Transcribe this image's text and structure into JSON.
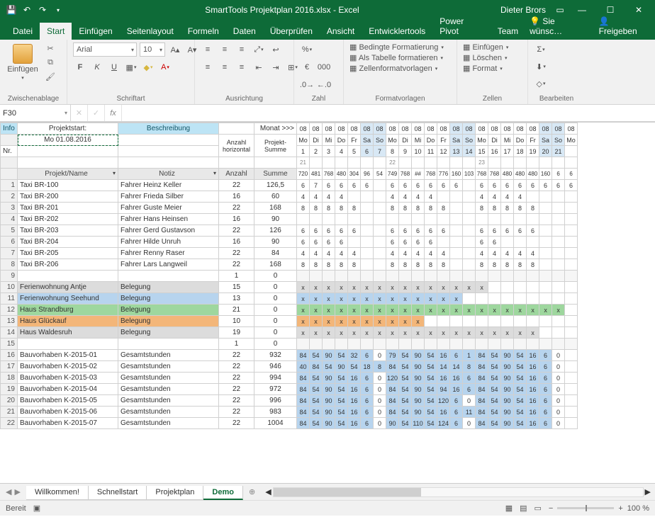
{
  "title": "SmartTools Projektplan 2016.xlsx - Excel",
  "user": "Dieter Brors",
  "ribbon_tabs": [
    "Datei",
    "Start",
    "Einfügen",
    "Seitenlayout",
    "Formeln",
    "Daten",
    "Überprüfen",
    "Ansicht",
    "Entwicklertools",
    "Power Pivot",
    "Team"
  ],
  "ribbon_active": 1,
  "wish_label": "Sie wünsc…",
  "share_label": "Freigeben",
  "groups": {
    "clipboard": "Zwischenablage",
    "font": "Schriftart",
    "align": "Ausrichtung",
    "number": "Zahl",
    "styles": "Formatvorlagen",
    "cells": "Zellen",
    "editing": "Bearbeiten"
  },
  "paste_label": "Einfügen",
  "font_name": "Arial",
  "font_size": "10",
  "font_btns": {
    "bold": "F",
    "italic": "K",
    "underline": "U"
  },
  "styles_items": [
    "Bedingte Formatierung",
    "Als Tabelle formatieren",
    "Zellenformatvorlagen"
  ],
  "cells_items": [
    "Einfügen",
    "Löschen",
    "Format"
  ],
  "namebox": "F30",
  "fx": "fx",
  "headers": {
    "info": "Info",
    "projektstart": "Projektstart:",
    "beschreibung": "Beschreibung",
    "monat": "Monat >>>",
    "anzahl_h": "Anzahl\nhorizontal",
    "projekt_summe": "Projekt-\nSumme",
    "nr": "Nr.",
    "projekt_name": "Projekt/Name",
    "notiz": "Notiz",
    "anzahl": "Anzahl",
    "summe": "Summe"
  },
  "projektstart_date": "Mo 01.08.2016",
  "day_months": [
    "08",
    "08",
    "08",
    "08",
    "08",
    "08",
    "08",
    "08",
    "08",
    "08",
    "08",
    "08",
    "08",
    "08",
    "08",
    "08",
    "08",
    "08",
    "08",
    "08",
    "08",
    "08"
  ],
  "weekdays": [
    "Mo",
    "Di",
    "Mi",
    "Do",
    "Fr",
    "Sa",
    "So",
    "Mo",
    "Di",
    "Mi",
    "Do",
    "Fr",
    "Sa",
    "So",
    "Mo",
    "Di",
    "Mi",
    "Do",
    "Fr",
    "Sa",
    "So",
    "Mo"
  ],
  "daynums": [
    "1",
    "2",
    "3",
    "4",
    "5",
    "6",
    "7",
    "8",
    "9",
    "10",
    "11",
    "12",
    "13",
    "14",
    "15",
    "16",
    "17",
    "18",
    "19",
    "20",
    "21",
    ""
  ],
  "weeknums": [
    "21",
    "",
    "",
    "",
    "",
    "",
    "",
    "22",
    "",
    "",
    "",
    "",
    "",
    "",
    "23",
    "",
    "",
    "",
    "",
    "",
    "",
    ""
  ],
  "totals_row": [
    "720",
    "481",
    "768",
    "480",
    "304",
    "96",
    "54",
    "749",
    "768",
    "##",
    "768",
    "776",
    "160",
    "103",
    "768",
    "768",
    "480",
    "480",
    "480",
    "160",
    "6",
    "6"
  ],
  "rows": [
    {
      "n": 1,
      "name": "Taxi BR-100",
      "notiz": "Fahrer Heinz Keller",
      "anz": 22,
      "sum": "126,5",
      "cells": [
        "6",
        "7",
        "6",
        "6",
        "6",
        "6",
        "",
        "6",
        "6",
        "6",
        "6",
        "6",
        "6",
        "",
        "6",
        "6",
        "6",
        "6",
        "6",
        "6",
        "6",
        "6"
      ]
    },
    {
      "n": 2,
      "name": "Taxi BR-200",
      "notiz": "Fahrer Frieda Silber",
      "anz": 16,
      "sum": "60",
      "cells": [
        "4",
        "4",
        "4",
        "4",
        "",
        "",
        "",
        "4",
        "4",
        "4",
        "4",
        "",
        "",
        "",
        "4",
        "4",
        "4",
        "4",
        "",
        "",
        "",
        ""
      ]
    },
    {
      "n": 3,
      "name": "Taxi BR-201",
      "notiz": "Fahrer Guste Meier",
      "anz": 22,
      "sum": "168",
      "cells": [
        "8",
        "8",
        "8",
        "8",
        "8",
        "",
        "",
        "8",
        "8",
        "8",
        "8",
        "8",
        "",
        "",
        "8",
        "8",
        "8",
        "8",
        "8",
        "",
        "",
        ""
      ]
    },
    {
      "n": 4,
      "name": "Taxi BR-202",
      "notiz": "Fahrer Hans Heinsen",
      "anz": 16,
      "sum": "90",
      "cells": [
        "",
        "",
        "",
        "",
        "",
        "",
        "",
        "",
        "",
        "",
        "",
        "",
        "",
        "",
        "",
        "",
        "",
        "",
        "",
        "",
        "",
        ""
      ]
    },
    {
      "n": 5,
      "name": "Taxi BR-203",
      "notiz": "Fahrer Gerd Gustavson",
      "anz": 22,
      "sum": "126",
      "cells": [
        "6",
        "6",
        "6",
        "6",
        "6",
        "",
        "",
        "6",
        "6",
        "6",
        "6",
        "6",
        "",
        "",
        "6",
        "6",
        "6",
        "6",
        "6",
        "",
        "",
        ""
      ]
    },
    {
      "n": 6,
      "name": "Taxi BR-204",
      "notiz": "Fahrer Hilde Unruh",
      "anz": 16,
      "sum": "90",
      "cells": [
        "6",
        "6",
        "6",
        "6",
        "",
        "",
        "",
        "6",
        "6",
        "6",
        "6",
        "",
        "",
        "",
        "6",
        "6",
        "",
        "",
        "",
        "",
        "",
        ""
      ]
    },
    {
      "n": 7,
      "name": "Taxi BR-205",
      "notiz": "Fahrer Renny Raser",
      "anz": 22,
      "sum": "84",
      "cells": [
        "4",
        "4",
        "4",
        "4",
        "4",
        "",
        "",
        "4",
        "4",
        "4",
        "4",
        "4",
        "",
        "",
        "4",
        "4",
        "4",
        "4",
        "4",
        "",
        "",
        ""
      ]
    },
    {
      "n": 8,
      "name": "Taxi BR-206",
      "notiz": "Fahrer Lars Langweil",
      "anz": 22,
      "sum": "168",
      "cells": [
        "8",
        "8",
        "8",
        "8",
        "8",
        "",
        "",
        "8",
        "8",
        "8",
        "8",
        "8",
        "",
        "",
        "8",
        "8",
        "8",
        "8",
        "8",
        "",
        "",
        ""
      ]
    },
    {
      "n": 9,
      "name": "",
      "notiz": "",
      "anz": 1,
      "sum": "0",
      "blank": true,
      "cells": [
        "",
        "",
        "",
        "",
        "",
        "",
        "",
        "",
        "",
        "",
        "",
        "",
        "",
        "",
        "",
        "",
        "",
        "",
        "",
        "",
        "",
        ""
      ]
    },
    {
      "n": 10,
      "name": "Ferienwohnung Antje",
      "notiz": "Belegung",
      "anz": 15,
      "sum": "0",
      "fill": "fillgrey",
      "mark": {
        "from": 0,
        "to": 14,
        "cls": "fillgrey"
      },
      "cells": [
        "x",
        "x",
        "x",
        "x",
        "x",
        "x",
        "x",
        "x",
        "x",
        "x",
        "x",
        "x",
        "x",
        "x",
        "x",
        "",
        "",
        "",
        "",
        "",
        "",
        ""
      ]
    },
    {
      "n": 11,
      "name": "Ferienwohnung Seehund",
      "notiz": "Belegung",
      "anz": 13,
      "sum": "0",
      "fill": "fillblue",
      "mark": {
        "from": 0,
        "to": 12,
        "cls": "fillblue"
      },
      "cells": [
        "x",
        "x",
        "x",
        "x",
        "x",
        "x",
        "x",
        "x",
        "x",
        "x",
        "x",
        "x",
        "x",
        "",
        "",
        "",
        "",
        "",
        "",
        "",
        "",
        ""
      ]
    },
    {
      "n": 12,
      "name": "Haus Strandburg",
      "notiz": "Belegung",
      "anz": 21,
      "sum": "0",
      "fill": "fillgreen",
      "mark": {
        "from": 0,
        "to": 20,
        "cls": "fillgreen"
      },
      "cells": [
        "x",
        "x",
        "x",
        "x",
        "x",
        "x",
        "x",
        "x",
        "x",
        "x",
        "x",
        "x",
        "x",
        "x",
        "x",
        "x",
        "x",
        "x",
        "x",
        "x",
        "x",
        ""
      ]
    },
    {
      "n": 13,
      "name": "Haus Glückauf",
      "notiz": "Belegung",
      "anz": 10,
      "sum": "0",
      "fill": "fillorange",
      "mark": {
        "from": 0,
        "to": 9,
        "cls": "fillorange"
      },
      "cells": [
        "x",
        "x",
        "x",
        "x",
        "x",
        "x",
        "x",
        "x",
        "x",
        "x",
        "",
        "",
        "",
        "",
        "",
        "",
        "",
        "",
        "",
        "",
        "",
        ""
      ]
    },
    {
      "n": 14,
      "name": "Haus Waldesruh",
      "notiz": "Belegung",
      "anz": 19,
      "sum": "0",
      "fill": "fillgrey",
      "mark": {
        "from": 0,
        "to": 18,
        "cls": "fillgrey"
      },
      "cells": [
        "x",
        "x",
        "x",
        "x",
        "x",
        "x",
        "x",
        "x",
        "x",
        "x",
        "x",
        "x",
        "x",
        "x",
        "x",
        "x",
        "x",
        "x",
        "x",
        "",
        "",
        ""
      ]
    },
    {
      "n": 15,
      "name": "",
      "notiz": "",
      "anz": 1,
      "sum": "0",
      "blank": true,
      "cells": [
        "",
        "",
        "",
        "",
        "",
        "",
        "",
        "",
        "",
        "",
        "",
        "",
        "",
        "",
        "",
        "",
        "",
        "",
        "",
        "",
        "",
        ""
      ]
    },
    {
      "n": 16,
      "name": "Bauvorhaben K-2015-01",
      "notiz": "Gesamtstunden",
      "anz": 22,
      "sum": "932",
      "cells": [
        "84",
        "54",
        "90",
        "54",
        "32",
        "6",
        "0",
        "79",
        "54",
        "90",
        "54",
        "16",
        "6",
        "1",
        "84",
        "54",
        "90",
        "54",
        "16",
        "6",
        "0",
        ""
      ]
    },
    {
      "n": 17,
      "name": "Bauvorhaben K-2015-02",
      "notiz": "Gesamtstunden",
      "anz": 22,
      "sum": "946",
      "cells": [
        "40",
        "84",
        "54",
        "90",
        "54",
        "18",
        "8",
        "84",
        "54",
        "90",
        "54",
        "14",
        "14",
        "8",
        "84",
        "54",
        "90",
        "54",
        "16",
        "6",
        "0",
        ""
      ]
    },
    {
      "n": 18,
      "name": "Bauvorhaben K-2015-03",
      "notiz": "Gesamtstunden",
      "anz": 22,
      "sum": "994",
      "cells": [
        "84",
        "54",
        "90",
        "54",
        "16",
        "6",
        "0",
        "120",
        "54",
        "90",
        "54",
        "16",
        "16",
        "6",
        "84",
        "54",
        "90",
        "54",
        "16",
        "6",
        "0",
        ""
      ]
    },
    {
      "n": 19,
      "name": "Bauvorhaben K-2015-04",
      "notiz": "Gesamtstunden",
      "anz": 22,
      "sum": "972",
      "cells": [
        "84",
        "54",
        "90",
        "54",
        "16",
        "6",
        "0",
        "84",
        "54",
        "90",
        "54",
        "94",
        "16",
        "6",
        "84",
        "54",
        "90",
        "54",
        "16",
        "6",
        "0",
        ""
      ]
    },
    {
      "n": 20,
      "name": "Bauvorhaben K-2015-05",
      "notiz": "Gesamtstunden",
      "anz": 22,
      "sum": "996",
      "cells": [
        "84",
        "54",
        "90",
        "54",
        "16",
        "6",
        "0",
        "84",
        "54",
        "90",
        "54",
        "120",
        "6",
        "0",
        "84",
        "54",
        "90",
        "54",
        "16",
        "6",
        "0",
        ""
      ]
    },
    {
      "n": 21,
      "name": "Bauvorhaben K-2015-06",
      "notiz": "Gesamtstunden",
      "anz": 22,
      "sum": "983",
      "cells": [
        "84",
        "54",
        "90",
        "54",
        "16",
        "6",
        "0",
        "84",
        "54",
        "90",
        "54",
        "16",
        "6",
        "11",
        "84",
        "54",
        "90",
        "54",
        "16",
        "6",
        "0",
        ""
      ]
    },
    {
      "n": 22,
      "name": "Bauvorhaben K-2015-07",
      "notiz": "Gesamtstunden",
      "anz": 22,
      "sum": "1004",
      "cells": [
        "84",
        "54",
        "90",
        "54",
        "16",
        "6",
        "0",
        "90",
        "54",
        "110",
        "54",
        "124",
        "6",
        "0",
        "84",
        "54",
        "90",
        "54",
        "16",
        "6",
        "0",
        ""
      ]
    }
  ],
  "sheet_tabs": [
    "Willkommen!",
    "Schnellstart",
    "Projektplan",
    "Demo"
  ],
  "sheet_active": 3,
  "status": {
    "ready": "Bereit",
    "zoom": "100 %"
  }
}
